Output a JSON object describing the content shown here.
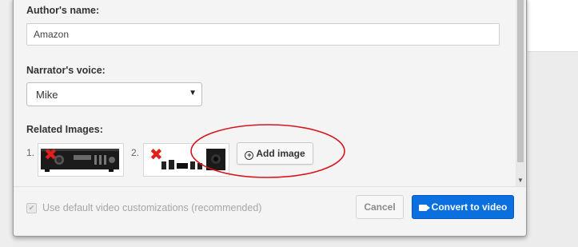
{
  "form": {
    "author_label": "Author's name:",
    "author_value": "Amazon",
    "narrator_label": "Narrator's voice:",
    "narrator_value": "Mike",
    "related_label": "Related Images:",
    "images": [
      {
        "index": "1.",
        "status_icon": "red-x-icon",
        "thumbnail": "av-receiver"
      },
      {
        "index": "2.",
        "status_icon": "red-x-icon",
        "thumbnail": "home-theater-speakers"
      }
    ],
    "add_image_label": "Add image"
  },
  "footer": {
    "checkbox_label": "Use default video customizations (recommended)",
    "checkbox_checked": true,
    "cancel_label": "Cancel",
    "convert_label": "Convert to video"
  },
  "colors": {
    "primary_button": "#0a6fdf",
    "annotation_ellipse": "#d8141c",
    "error_mark": "#e0211a"
  }
}
